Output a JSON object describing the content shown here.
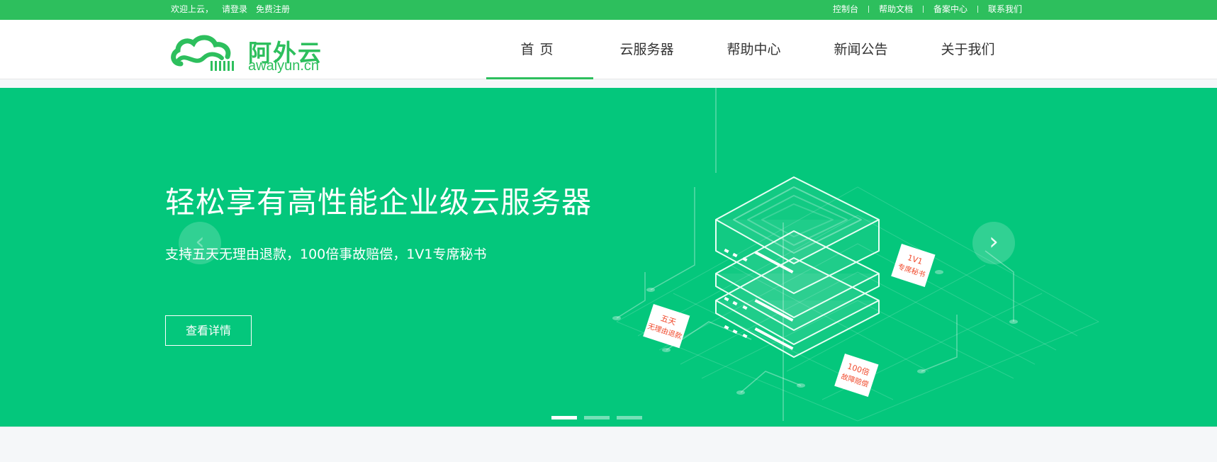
{
  "topbar": {
    "welcome": "欢迎上云，",
    "login": "请登录",
    "register": "免费注册",
    "links": [
      "控制台",
      "帮助文档",
      "备案中心",
      "联系我们"
    ]
  },
  "logo": {
    "name_cn": "阿外云",
    "name_en": "awaiyun.cn",
    "icon": "cloud-logo-icon"
  },
  "nav": {
    "items": [
      "首页",
      "云服务器",
      "帮助中心",
      "新闻公告",
      "关于我们"
    ],
    "active_index": 0
  },
  "banner": {
    "title": "轻松享有高性能企业级云服务器",
    "subtitle": "支持五天无理由退款，100倍事故赔偿，1V1专席秘书",
    "button": "查看详情",
    "tags": [
      "五天",
      "无理由退款",
      "100倍",
      "故障赔偿",
      "1V1",
      "专席秘书"
    ],
    "slides_count": 3,
    "active_slide": 0
  },
  "colors": {
    "brand": "#2dbf5d",
    "banner_bg": "#04c77c"
  }
}
